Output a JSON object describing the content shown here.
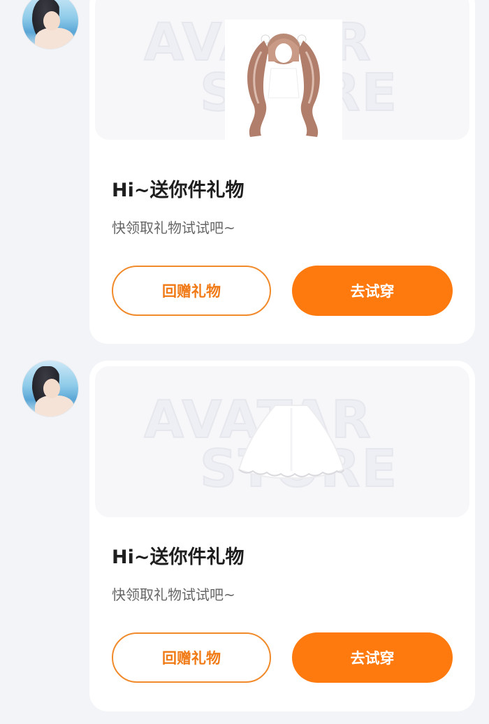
{
  "messages": [
    {
      "title": "Hi~送你件礼物",
      "subtitle": "快领取礼物试试吧~",
      "return_gift_label": "回赠礼物",
      "try_on_label": "去试穿",
      "watermark_line1": "AVATAR",
      "watermark_line2": "STORE",
      "item_icon": "twin-tails-wig-icon"
    },
    {
      "title": "Hi~送你件礼物",
      "subtitle": "快领取礼物试试吧~",
      "return_gift_label": "回赠礼物",
      "try_on_label": "去试穿",
      "watermark_line1": "AVATAR",
      "watermark_line2": "STORE",
      "item_icon": "white-skirt-icon"
    }
  ],
  "colors": {
    "accent": "#ff7a0e",
    "outline": "#f18a2b",
    "background": "#f3f4f8"
  }
}
